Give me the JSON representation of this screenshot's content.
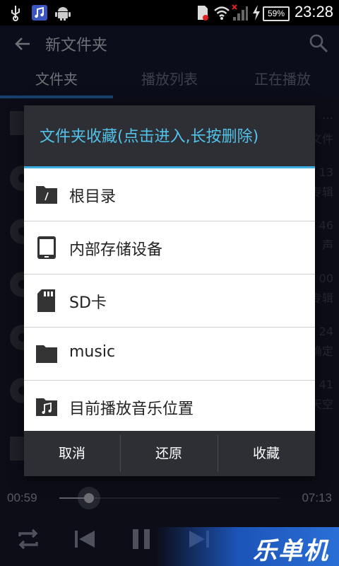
{
  "status_bar": {
    "time": "23:28",
    "battery": "59%",
    "icons": [
      "usb-icon",
      "music-app-icon",
      "android-icon",
      "sim-icon",
      "wifi-icon",
      "signal-icon",
      "charging-icon",
      "battery-icon"
    ]
  },
  "app_bar": {
    "title": "新文件夹"
  },
  "tabs": [
    {
      "label": "文件夹"
    },
    {
      "label": "播放列表"
    },
    {
      "label": "正在播放"
    }
  ],
  "background_list": {
    "right_texts": [
      {
        "top": "…",
        "bottom": "文件"
      },
      {
        "top": "13",
        "bottom": "专辑"
      },
      {
        "top": "46",
        "bottom": "声"
      },
      {
        "top": "00",
        "bottom": "专辑"
      },
      {
        "top": "24",
        "bottom": "确定"
      },
      {
        "top": "41",
        "bottom": "天空"
      }
    ]
  },
  "dialog": {
    "title": "文件夹收藏(点击进入,长按删除)",
    "items": [
      {
        "label": "根目录",
        "icon": "root-folder-icon"
      },
      {
        "label": "内部存储设备",
        "icon": "phone-storage-icon"
      },
      {
        "label": "SD卡",
        "icon": "sd-card-icon"
      },
      {
        "label": "music",
        "icon": "folder-icon"
      },
      {
        "label": "目前播放音乐位置",
        "icon": "music-folder-icon"
      }
    ],
    "buttons": {
      "cancel": "取消",
      "restore": "还原",
      "favorite": "收藏"
    }
  },
  "player": {
    "elapsed": "00:59",
    "duration": "07:13",
    "progress": 0.136
  },
  "watermark": "乐单机",
  "colors": {
    "accent": "#2b76c9",
    "dialog_title": "#52c2ea",
    "dialog_bar": "#2d2f35"
  }
}
